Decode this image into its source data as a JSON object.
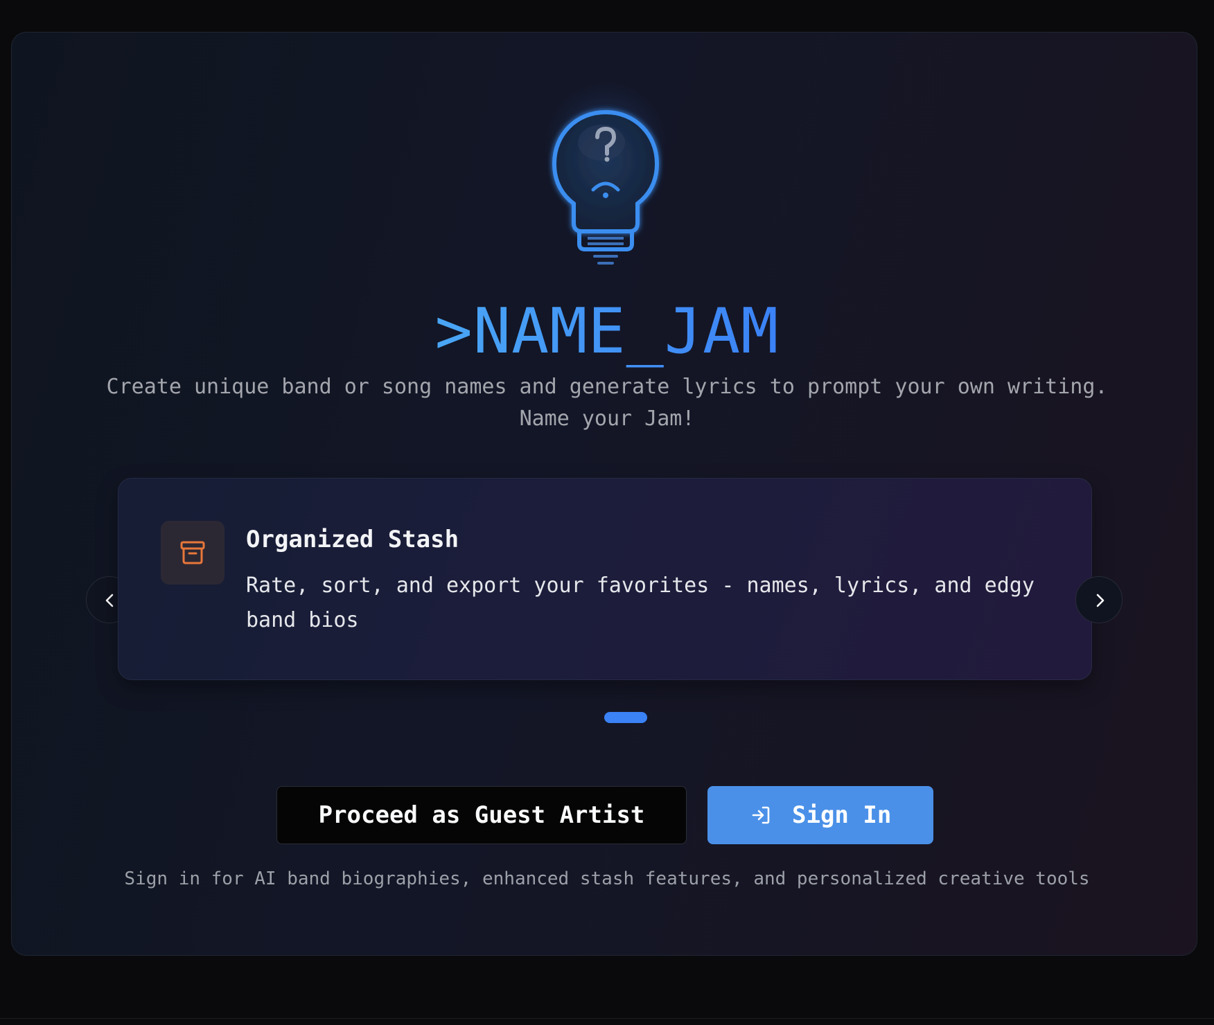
{
  "app": {
    "brand": ">NAME_JAM",
    "tagline": "Create unique band or song names and generate lyrics to prompt your own writing. Name your Jam!"
  },
  "hero_icon": "lightbulb-question-icon",
  "carousel": {
    "active_index": 0,
    "slide_count": 1,
    "prev_icon": "chevron-left-icon",
    "next_icon": "chevron-right-icon",
    "slide": {
      "icon": "archive-box-icon",
      "title": "Organized Stash",
      "description": "Rate, sort, and export your favorites - names, lyrics, and edgy band bios"
    }
  },
  "actions": {
    "guest_label": "Proceed as Guest Artist",
    "signin_label": "Sign In",
    "signin_icon": "sign-in-arrow-icon"
  },
  "footnote": "Sign in for AI band biographies, enhanced stash features, and personalized creative tools",
  "colors": {
    "accent_blue": "#3b82f6",
    "signin_button": "#4a90e8",
    "feature_icon_orange": "#e8773a",
    "background": "#0a0a0c"
  }
}
